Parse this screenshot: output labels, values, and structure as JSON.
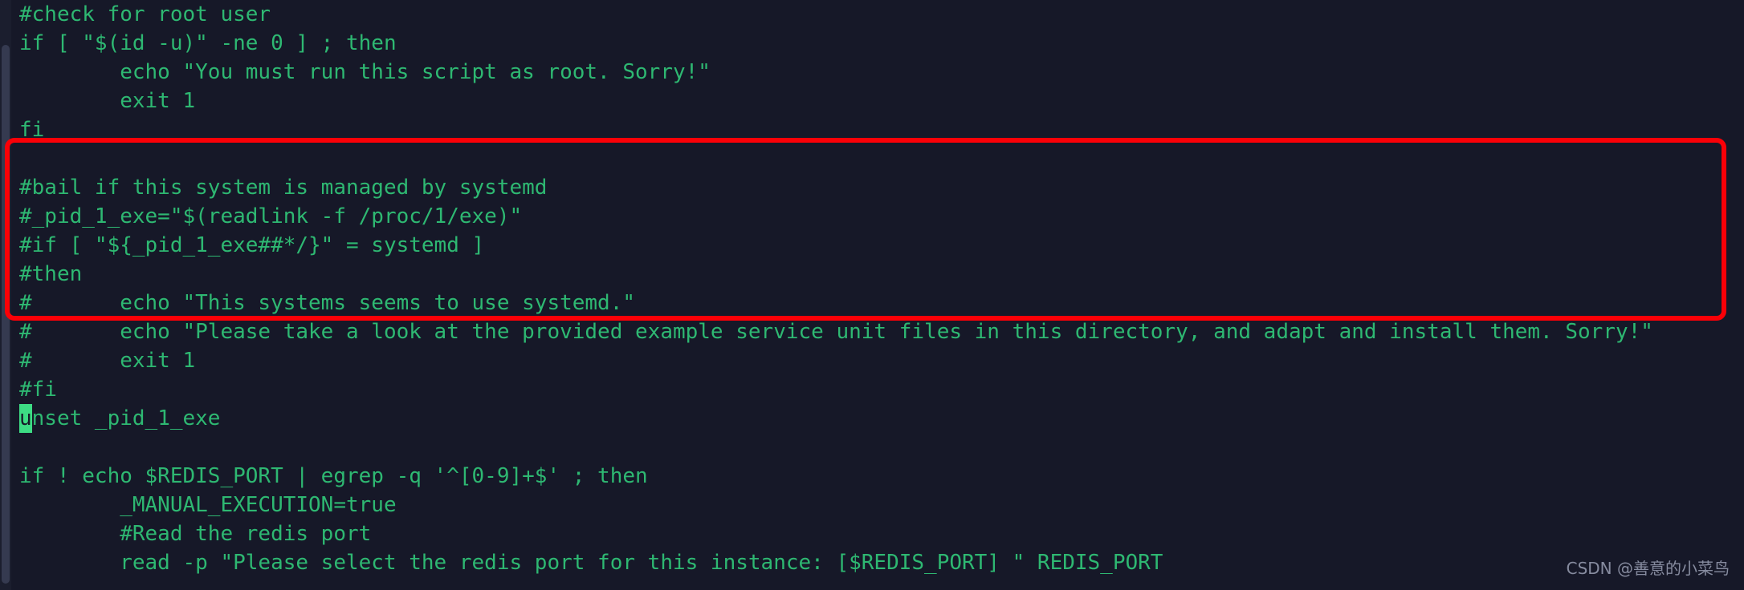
{
  "window": {
    "kind": "terminal-code-editor",
    "background_color": "#161828",
    "code_color": "#2eb872",
    "annotation_color": "#fb0007",
    "cursor_color": "#3ddc84"
  },
  "watermark": {
    "text": "CSDN @善意的小菜鸟"
  },
  "code": {
    "lines": [
      {
        "id": "l1",
        "text": "#check for root user",
        "boxed": false
      },
      {
        "id": "l2",
        "text": "if [ \"$(id -u)\" -ne 0 ] ; then",
        "boxed": false
      },
      {
        "id": "l3",
        "text": "        echo \"You must run this script as root. Sorry!\"",
        "boxed": false
      },
      {
        "id": "l4",
        "text": "        exit 1",
        "boxed": false
      },
      {
        "id": "l5",
        "text": "fi",
        "boxed": false
      },
      {
        "id": "l6",
        "text": "",
        "boxed": false
      },
      {
        "id": "l7",
        "text": "#bail if this system is managed by systemd",
        "boxed": true
      },
      {
        "id": "l8",
        "text": "#_pid_1_exe=\"$(readlink -f /proc/1/exe)\"",
        "boxed": true
      },
      {
        "id": "l9",
        "text": "#if [ \"${_pid_1_exe##*/}\" = systemd ]",
        "boxed": true
      },
      {
        "id": "l10",
        "text": "#then",
        "boxed": true
      },
      {
        "id": "l11",
        "text": "#       echo \"This systems seems to use systemd.\"",
        "boxed": true
      },
      {
        "id": "l12",
        "text": "#       echo \"Please take a look at the provided example service unit files in this directory, and adapt and install them. Sorry!\"",
        "boxed": true
      },
      {
        "id": "l13",
        "text": "#       exit 1",
        "boxed": true
      },
      {
        "id": "l14",
        "text": "#fi",
        "boxed": true
      },
      {
        "id": "l15",
        "text": "unset _pid_1_exe",
        "boxed": false,
        "cursor_index": 0
      },
      {
        "id": "l16",
        "text": "",
        "boxed": false
      },
      {
        "id": "l17",
        "text": "if ! echo $REDIS_PORT | egrep -q '^[0-9]+$' ; then",
        "boxed": false
      },
      {
        "id": "l18",
        "text": "        _MANUAL_EXECUTION=true",
        "boxed": false
      },
      {
        "id": "l19",
        "text": "        #Read the redis port",
        "boxed": false
      },
      {
        "id": "l20",
        "text": "        read -p \"Please select the redis port for this instance: [$REDIS_PORT] \" REDIS_PORT",
        "boxed": false
      }
    ],
    "annotation": {
      "shape": "rounded-rectangle",
      "covers_lines": [
        "l7",
        "l8",
        "l9",
        "l10",
        "l11",
        "l12",
        "l13",
        "l14"
      ]
    }
  }
}
